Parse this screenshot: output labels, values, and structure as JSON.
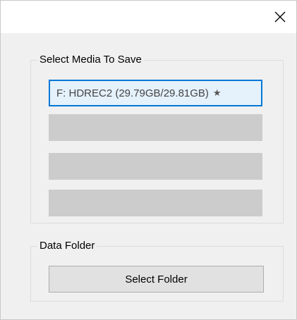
{
  "window": {
    "close_glyph": "close-icon"
  },
  "media_group": {
    "legend": "Select Media To Save",
    "slots": [
      {
        "label": "F:  HDREC2 (29.79GB/29.81GB)",
        "marker": "★",
        "selected": true
      },
      {
        "label": "",
        "selected": false
      },
      {
        "label": "",
        "selected": false
      },
      {
        "label": "",
        "selected": false
      }
    ]
  },
  "folder_group": {
    "legend": "Data Folder",
    "button_label": "Select Folder"
  },
  "colors": {
    "accent": "#0078d7",
    "selected_bg": "#e5f1fb",
    "empty_slot": "#cccccc",
    "button_bg": "#e1e1e1"
  }
}
